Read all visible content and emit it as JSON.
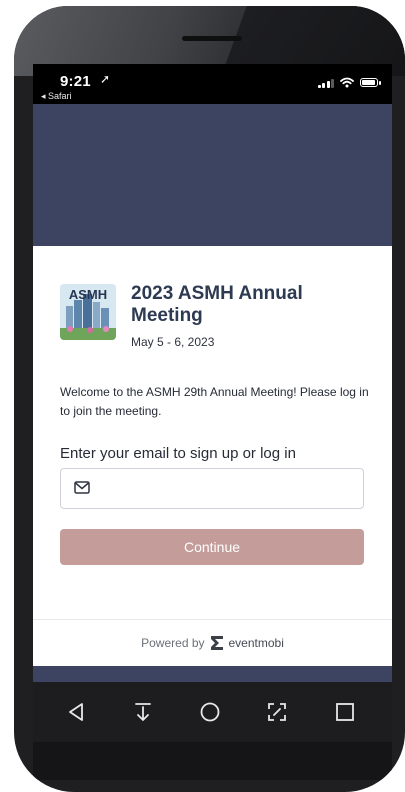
{
  "status_bar": {
    "time": "9:21",
    "back_app": "◂ Safari"
  },
  "event": {
    "title": "2023 ASMH Annual Meeting",
    "dates": "May 5 - 6, 2023",
    "logo_text": "ASMH"
  },
  "login": {
    "welcome": "Welcome to the ASMH 29th Annual Meeting! Please log in to join the meeting.",
    "email_label": "Enter your email to sign up or log in",
    "email_value": "",
    "email_placeholder": "",
    "continue_label": "Continue"
  },
  "footer": {
    "powered_by": "Powered by",
    "brand": "eventmobi"
  },
  "colors": {
    "app_background": "#3d4461",
    "continue_button": "#c49c9a",
    "title": "#2d3a52"
  },
  "nav_icons": [
    "back-triangle-icon",
    "download-arrow-icon",
    "home-circle-icon",
    "expand-icon",
    "recents-square-icon"
  ]
}
